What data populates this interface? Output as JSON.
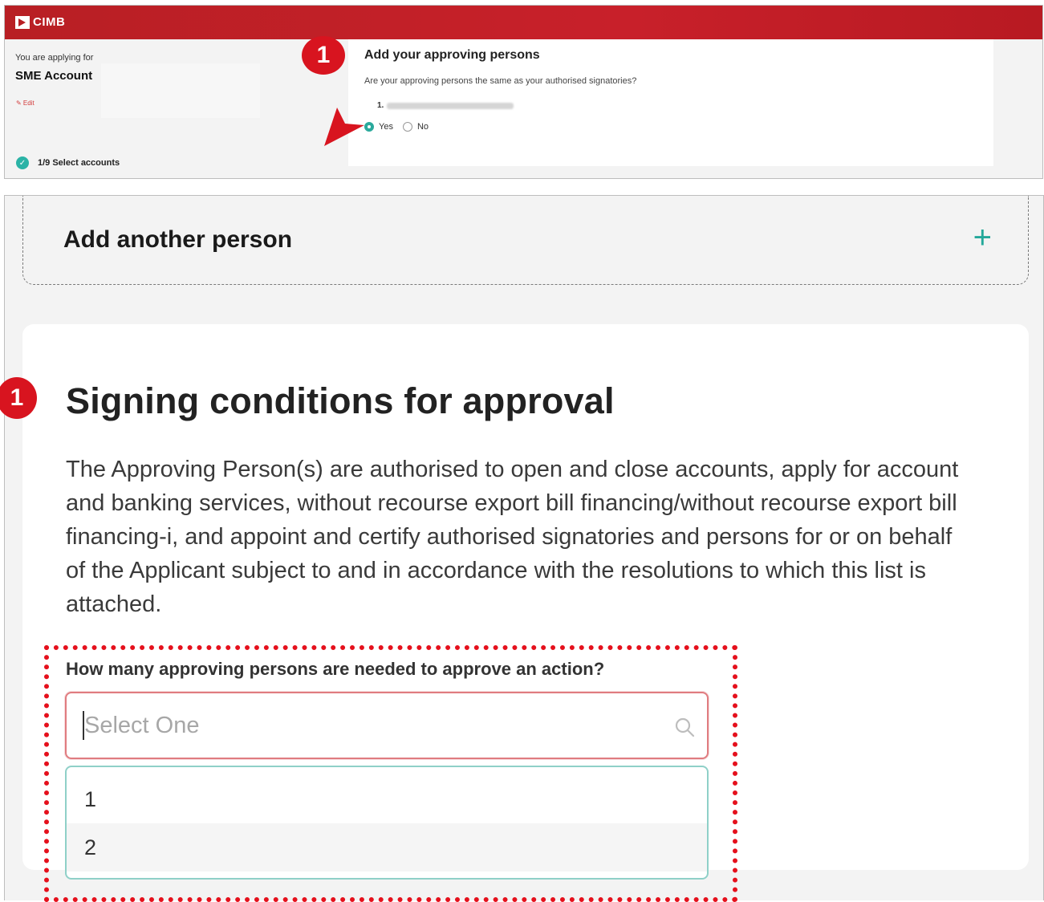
{
  "header": {
    "logo_text": "CIMB"
  },
  "sidebar": {
    "applying_label": "You are applying for",
    "applying_value": "SME Account",
    "edit_label": "✎ Edit",
    "step_status": "1/9 Select accounts"
  },
  "approving_card": {
    "title": "Add your approving persons",
    "question": "Are your approving persons the same as your authorised signatories?",
    "person_number": "1.",
    "options": [
      {
        "label": "Yes",
        "selected": true
      },
      {
        "label": "No",
        "selected": false
      }
    ]
  },
  "badges": {
    "step": "1"
  },
  "add_person": {
    "label": "Add another person",
    "icon": "plus-icon"
  },
  "signing": {
    "title": "Signing conditions for approval",
    "body": "The Approving Person(s) are authorised to open and close accounts, apply for account and banking services, without recourse export bill financing/without recourse export bill financing-i, and appoint and certify authorised signatories and persons for or on behalf of the Applicant subject to and in accordance with the resolutions to which this list is attached.",
    "question": "How many approving persons are needed to approve an action?",
    "select_placeholder": "Select One",
    "dropdown_options": [
      "1",
      "2"
    ]
  },
  "colors": {
    "brand_red": "#c8202a",
    "accent_teal": "#2aa99c",
    "highlight_red": "#e5101c"
  }
}
